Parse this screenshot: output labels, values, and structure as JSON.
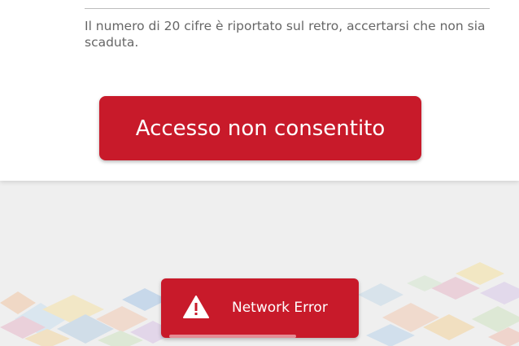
{
  "card_number_hint": "Il numero di 20 cifre è riportato sul retro, accertarsi che non sia scaduta.",
  "primary_button_label": "Accesso non consentito",
  "toast": {
    "icon": "warning-icon",
    "message": "Network Error"
  },
  "colors": {
    "brand_red": "#c81a2a",
    "background": "#efefef",
    "hint_text": "#666666"
  }
}
